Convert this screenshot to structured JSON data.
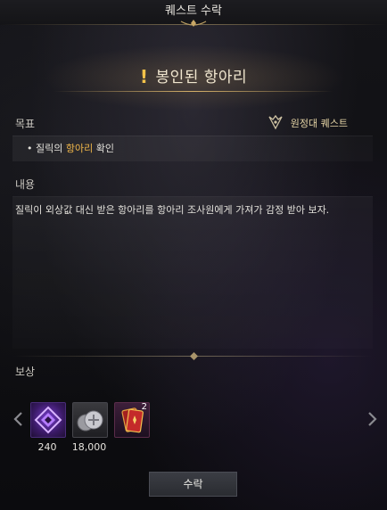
{
  "window": {
    "title": "퀘스트 수락"
  },
  "quest": {
    "title": "봉인된 항아리"
  },
  "sections": {
    "goal_label": "목표",
    "content_label": "내용",
    "reward_label": "보상"
  },
  "badge": {
    "label": "원정대 퀘스트"
  },
  "goal": {
    "bullet": "•",
    "prefix": "질릭의 ",
    "highlight": "항아리",
    "suffix": " 확인"
  },
  "content": {
    "text": "질릭이 외상값 대신 받은 항아리를 항아리 조사원에게 가져가 감정 받아 보자."
  },
  "rewards": [
    {
      "icon": "purple-crystal-icon",
      "count": "240"
    },
    {
      "icon": "silver-coins-icon",
      "count": "18,000"
    },
    {
      "icon": "red-card-icon",
      "count": "2"
    }
  ],
  "buttons": {
    "accept": "수락"
  },
  "colors": {
    "highlight": "#f2b84a",
    "accent": "#f3c24a"
  }
}
